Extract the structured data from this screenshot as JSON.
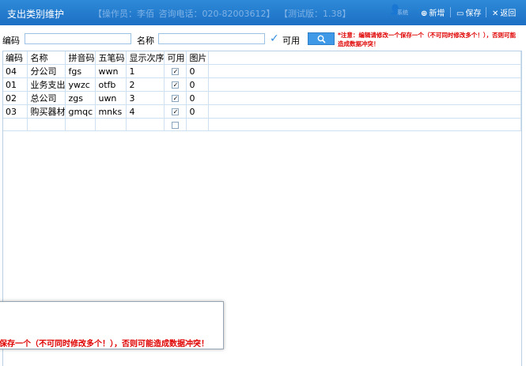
{
  "titlebar": {
    "title": "支出类别维护",
    "operator": "【操作员：李佰",
    "phone": "咨询电话：020-82003612】",
    "version": "【测试版：1.38】",
    "user_label": "系统",
    "new_label": "新增",
    "save_label": "保存",
    "back_label": "返回"
  },
  "search": {
    "code_label": "编码",
    "code_value": "",
    "name_label": "名称",
    "name_value": "",
    "enabled_label": "可用",
    "notice": "*注意：编辑请修改一个保存一个（不可同时修改多个！），否则可能造成数据冲突！"
  },
  "grid": {
    "columns": [
      "编码",
      "名称",
      "拼音码",
      "五笔码",
      "显示次序",
      "可用",
      "图片"
    ],
    "rows": [
      {
        "code": "04",
        "name": "分公司",
        "pinyin": "fgs",
        "wubi": "wwn",
        "order": "1",
        "enabled": "✓",
        "pic": "0"
      },
      {
        "code": "01",
        "name": "业务支出",
        "pinyin": "ywzc",
        "wubi": "otfb",
        "order": "2",
        "enabled": "✓",
        "pic": "0"
      },
      {
        "code": "02",
        "name": "总公司",
        "pinyin": "zgs",
        "wubi": "uwn",
        "order": "3",
        "enabled": "✓",
        "pic": "0"
      },
      {
        "code": "03",
        "name": "购买器材",
        "pinyin": "gmqc",
        "wubi": "mnks",
        "order": "4",
        "enabled": "✓",
        "pic": "0"
      },
      {
        "code": "",
        "name": "",
        "pinyin": "",
        "wubi": "",
        "order": "",
        "enabled": "",
        "pic": ""
      }
    ]
  },
  "popup": {
    "message": "保存一个（不可同时修改多个！），否则可能造成数据冲突！"
  },
  "colors": {
    "titlebar": "#2180d0",
    "accent": "#3f99e6",
    "notice": "#e00000"
  }
}
